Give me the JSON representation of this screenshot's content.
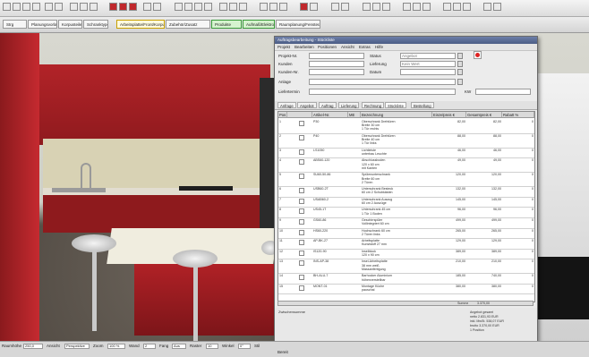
{
  "toolbar2": {
    "tabs": [
      "Strg",
      "Planungsvorlagen",
      "Korpusteile",
      "Schranktypen",
      "Arbeitsplatte/Front/Korpus",
      "Zubehör/Zusatz",
      "Produkte",
      "Aufmaß/Elektro",
      "Raumplanung/Fenster/Türen"
    ]
  },
  "dialog": {
    "title": "Auftragsbearbeitung - Stückliste",
    "menu": [
      "Projekt",
      "Bearbeiten",
      "Positionen",
      "Ansicht",
      "Extras",
      "Hilfe"
    ],
    "fields": {
      "projekt_nr_label": "Projekt-Nr.",
      "projekt_nr": "",
      "status_label": "Status",
      "status": "Angebot",
      "kunden_label": "Kunden",
      "kunden": "",
      "lieferung_label": "Lieferung",
      "lieferung": "Kein Wert",
      "kundennr_label": "Kunden-Nr.",
      "kundennr": "",
      "stand_label": "Datum",
      "stand": "",
      "anlage_label": "Anlage",
      "anlage": "",
      "liefertermin_label": "Liefertermin",
      "liefertermin": "",
      "kw_label": "KW"
    },
    "tabs": [
      "Anfrage",
      "Angebot",
      "Auftrag",
      "Lieferung",
      "Rechnung",
      "Stückliste",
      "Bestellung"
    ],
    "table": {
      "headers": [
        "Pos",
        "",
        "Artikel-Nr.",
        "ME",
        "Bezeichnung",
        "Einzelpreis €",
        "Gesamtpreis €",
        "Rabatt %"
      ],
      "rows": [
        [
          "1",
          "",
          "P30",
          "",
          "Oberschrank Drehtüren\nBreite 30 cm\n1 Tür rechts",
          "82,00",
          "82,00",
          "0"
        ],
        [
          "2",
          "",
          "P40",
          "",
          "Oberschrank Drehtüren\nBreite 40 cm\n1 Tür links",
          "88,00",
          "88,00",
          "0"
        ],
        [
          "3",
          "",
          "LS1050",
          "",
          "Lichtleiste\nunterbau Leuchte",
          "46,00",
          "46,00",
          "0"
        ],
        [
          "4",
          "",
          "ABS60-120",
          "",
          "Abschlussboden\n120 x 60 cm\nmit Kanten",
          "49,00",
          "49,00",
          "0"
        ],
        [
          "5",
          "",
          "SU60-50-86",
          "",
          "Spülenunterschrank\nBreite 60 cm\n2 Türen",
          "120,00",
          "120,00",
          "0"
        ],
        [
          "6",
          "",
          "USB60-2T",
          "",
          "Unterschrank Besteck\n60 cm 2 Schubkästen",
          "132,00",
          "132,00",
          "0"
        ],
        [
          "7",
          "",
          "USAB60-2",
          "",
          "Unterschrank Auszug\n60 cm 2 Auszüge",
          "145,00",
          "145,00",
          "0"
        ],
        [
          "8",
          "",
          "US45-1T",
          "",
          "Unterschrank 45 cm\n1 Tür 1 Boden",
          "96,00",
          "96,00",
          "0"
        ],
        [
          "9",
          "",
          "GS60-86",
          "",
          "Geschirrspüler\nVollintegriert 60 cm",
          "499,00",
          "499,00",
          "0"
        ],
        [
          "10",
          "",
          "HS60-220",
          "",
          "Hochschrank 60 cm\n2 Türen links",
          "265,00",
          "265,00",
          "0"
        ],
        [
          "11",
          "",
          "AP-BK-27",
          "",
          "Arbeitsplatte\nKunststoff 27 mm",
          "129,00",
          "129,00",
          "0"
        ],
        [
          "12",
          "",
          "IS120-90",
          "",
          "Inselblock\n120 x 90 cm",
          "389,00",
          "389,00",
          "0"
        ],
        [
          "13",
          "",
          "INS-AP-38",
          "",
          "Insel-Arbeitsplatte\n38 mm weiß\nMassanfertigung",
          "210,00",
          "210,00",
          "0"
        ],
        [
          "14",
          "",
          "BH-ALU-7",
          "",
          "Barhocker Aluminium\nhöhenverstellbar",
          "185,00",
          "740,00",
          "0"
        ],
        [
          "15",
          "",
          "MONT-01",
          "",
          "Montage Küche\npauschal",
          "380,00",
          "380,00",
          "0"
        ]
      ],
      "total_label": "Summe",
      "total_value": "3.370,00"
    },
    "bottom": {
      "left_label": "Zwischensumme",
      "right_lines": [
        "Angebot gesamt",
        "netto 2.831,93 EUR",
        "inkl. MwSt. 538,07 EUR",
        "brutto 3.370,00 EUR",
        "1 Position"
      ]
    }
  },
  "statusbar": {
    "items": [
      "Raumhöhe",
      "250,0",
      "Ansicht",
      "Perspektive",
      "Zoom",
      "100 %",
      "Wand",
      "2",
      "Fang",
      "Aus",
      "Raster",
      "10",
      "Winkel",
      "0°",
      "Stil"
    ],
    "center_text": "Bereit"
  },
  "colors": {
    "cabinet_red": "#b22328",
    "dialog_title": "#4b5d86",
    "viewport_wall": "#d8d8d0"
  },
  "icons": [
    "select-icon",
    "zoom-icon",
    "rotate-icon",
    "walk-icon",
    "render-icon",
    "print-icon",
    "undo-icon",
    "redo-icon",
    "help-icon"
  ]
}
